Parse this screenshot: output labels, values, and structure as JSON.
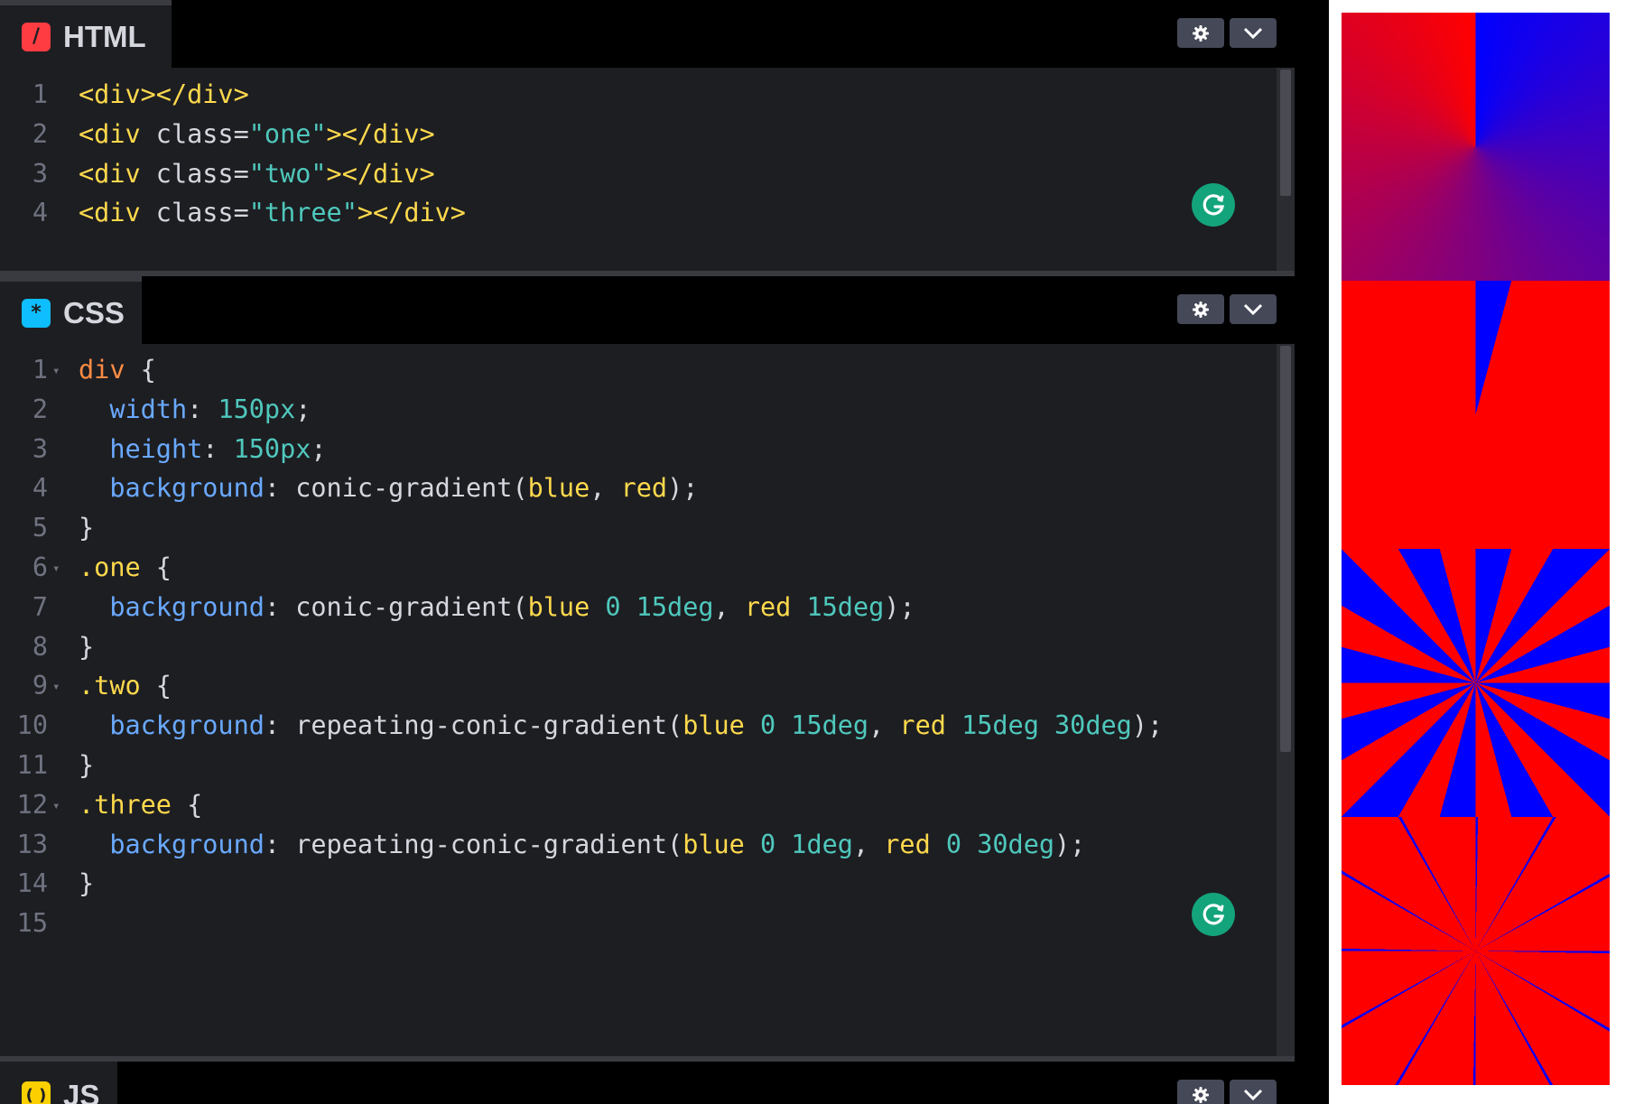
{
  "html_panel": {
    "label": "HTML",
    "icon": "html-slash-icon",
    "lines": [
      {
        "n": "1",
        "tokens": [
          [
            "c-tag",
            "<div></div>"
          ]
        ]
      },
      {
        "n": "2",
        "tokens": [
          [
            "c-tag",
            "<div "
          ],
          [
            "c-attr",
            "class="
          ],
          [
            "c-str",
            "\"one\""
          ],
          [
            "c-tag",
            "></div>"
          ]
        ]
      },
      {
        "n": "3",
        "tokens": [
          [
            "c-tag",
            "<div "
          ],
          [
            "c-attr",
            "class="
          ],
          [
            "c-str",
            "\"two\""
          ],
          [
            "c-tag",
            "></div>"
          ]
        ]
      },
      {
        "n": "4",
        "tokens": [
          [
            "c-tag",
            "<div "
          ],
          [
            "c-attr",
            "class="
          ],
          [
            "c-str",
            "\"three\""
          ],
          [
            "c-tag",
            "></div>"
          ]
        ]
      }
    ]
  },
  "css_panel": {
    "label": "CSS",
    "icon": "css-asterisk-icon",
    "lines": [
      {
        "n": "1",
        "fold": true,
        "tokens": [
          [
            "c-sel",
            "div"
          ],
          [
            "c-punc",
            " {"
          ]
        ]
      },
      {
        "n": "2",
        "tokens": [
          [
            "c-prop",
            "  width"
          ],
          [
            "c-punc",
            ": "
          ],
          [
            "c-num",
            "150px"
          ],
          [
            "c-punc",
            ";"
          ]
        ]
      },
      {
        "n": "3",
        "tokens": [
          [
            "c-prop",
            "  height"
          ],
          [
            "c-punc",
            ": "
          ],
          [
            "c-num",
            "150px"
          ],
          [
            "c-punc",
            ";"
          ]
        ]
      },
      {
        "n": "4",
        "tokens": [
          [
            "c-prop",
            "  background"
          ],
          [
            "c-punc",
            ": conic-gradient("
          ],
          [
            "c-kw",
            "blue"
          ],
          [
            "c-punc",
            ", "
          ],
          [
            "c-kw",
            "red"
          ],
          [
            "c-punc",
            ");"
          ]
        ]
      },
      {
        "n": "5",
        "tokens": [
          [
            "c-punc",
            "}"
          ]
        ]
      },
      {
        "n": "6",
        "fold": true,
        "tokens": [
          [
            "c-cls",
            ".one"
          ],
          [
            "c-punc",
            " {"
          ]
        ]
      },
      {
        "n": "7",
        "tokens": [
          [
            "c-prop",
            "  background"
          ],
          [
            "c-punc",
            ": conic-gradient("
          ],
          [
            "c-kw",
            "blue "
          ],
          [
            "c-num",
            "0 15deg"
          ],
          [
            "c-punc",
            ", "
          ],
          [
            "c-kw",
            "red "
          ],
          [
            "c-num",
            "15deg"
          ],
          [
            "c-punc",
            ");"
          ]
        ]
      },
      {
        "n": "8",
        "tokens": [
          [
            "c-punc",
            "}"
          ]
        ]
      },
      {
        "n": "9",
        "fold": true,
        "tokens": [
          [
            "c-cls",
            ".two"
          ],
          [
            "c-punc",
            " {"
          ]
        ]
      },
      {
        "n": "10",
        "tokens": [
          [
            "c-prop",
            "  background"
          ],
          [
            "c-punc",
            ": repeating-conic-gradient("
          ],
          [
            "c-kw",
            "blue "
          ],
          [
            "c-num",
            "0 15deg"
          ],
          [
            "c-punc",
            ", "
          ],
          [
            "c-kw",
            "red "
          ],
          [
            "c-num",
            "15deg 30deg"
          ],
          [
            "c-punc",
            ");"
          ]
        ]
      },
      {
        "n": "11",
        "tokens": [
          [
            "c-punc",
            "}"
          ]
        ]
      },
      {
        "n": "12",
        "fold": true,
        "tokens": [
          [
            "c-cls",
            ".three"
          ],
          [
            "c-punc",
            " {"
          ]
        ]
      },
      {
        "n": "13",
        "tokens": [
          [
            "c-prop",
            "  background"
          ],
          [
            "c-punc",
            ": repeating-conic-gradient("
          ],
          [
            "c-kw",
            "blue "
          ],
          [
            "c-num",
            "0 1deg"
          ],
          [
            "c-punc",
            ", "
          ],
          [
            "c-kw",
            "red "
          ],
          [
            "c-num",
            "0 30deg"
          ],
          [
            "c-punc",
            ");"
          ]
        ]
      },
      {
        "n": "14",
        "tokens": [
          [
            "c-punc",
            "}"
          ]
        ]
      },
      {
        "n": "15",
        "tokens": []
      }
    ]
  },
  "js_panel": {
    "label": "JS",
    "icon": "js-braces-icon"
  },
  "header_buttons": {
    "settings_icon": "gear-icon",
    "collapse_icon": "chevron-down-icon"
  },
  "colors": {
    "editor_bg": "#1d1e22",
    "html_icon_bg": "#ff3c41",
    "css_icon_bg": "#0ebeff",
    "js_icon_bg": "#fcd000",
    "grammarly": "#14a47c"
  }
}
